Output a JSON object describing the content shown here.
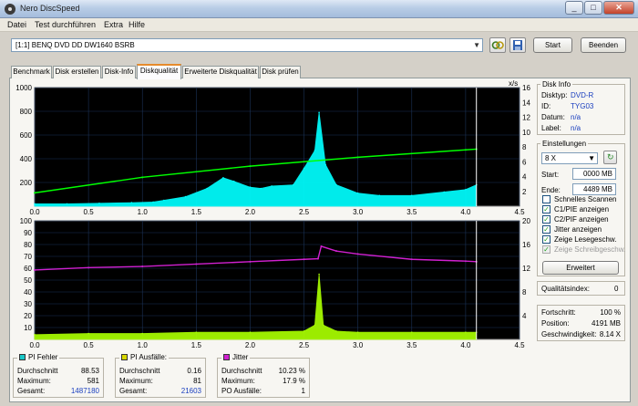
{
  "window": {
    "title": "Nero DiscSpeed"
  },
  "menu": [
    "Datei",
    "Test durchführen",
    "Extra",
    "Hilfe"
  ],
  "toolbar": {
    "drive": "[1:1]  BENQ DVD DD DW1640 BSRB",
    "start_label": "Start",
    "exit_label": "Beenden"
  },
  "tabs": [
    "Benchmark",
    "Disk erstellen",
    "Disk-Info",
    "Diskqualität",
    "Erweiterte Diskqualität",
    "Disk prüfen"
  ],
  "active_tab": 3,
  "disc_info": {
    "title": "Disk Info",
    "rows": [
      {
        "label": "Disktyp:",
        "value": "DVD-R"
      },
      {
        "label": "ID:",
        "value": "TYG03"
      },
      {
        "label": "Datum:",
        "value": "n/a"
      },
      {
        "label": "Label:",
        "value": "n/a"
      }
    ]
  },
  "settings": {
    "title": "Einstellungen",
    "speed": "8 X",
    "start_label": "Start:",
    "start_value": "0000 MB",
    "end_label": "Ende:",
    "end_value": "4489 MB",
    "options": [
      {
        "label": "Schnelles Scannen",
        "checked": false,
        "disabled": false
      },
      {
        "label": "C1/PIE anzeigen",
        "checked": true,
        "disabled": false
      },
      {
        "label": "C2/PIF anzeigen",
        "checked": true,
        "disabled": false
      },
      {
        "label": "Jitter anzeigen",
        "checked": true,
        "disabled": false
      },
      {
        "label": "Zeige Lesegeschw.",
        "checked": true,
        "disabled": false
      },
      {
        "label": "Zeige Schreibgeschw.",
        "checked": true,
        "disabled": true
      }
    ],
    "advanced_label": "Erweitert"
  },
  "quality": {
    "label": "Qualitätsindex:",
    "value": "0"
  },
  "progress": {
    "rows": [
      {
        "label": "Fortschritt:",
        "value": "100 %"
      },
      {
        "label": "Position:",
        "value": "4191 MB"
      },
      {
        "label": "Geschwindigkeit:",
        "value": "8.14 X"
      }
    ]
  },
  "stats": {
    "pi_errors": {
      "title": "PI Fehler",
      "color": "#19c8c8",
      "rows": [
        {
          "label": "Durchschnitt",
          "value": "88.53"
        },
        {
          "label": "Maximum:",
          "value": "581"
        },
        {
          "label": "Gesamt:",
          "value": "1487180"
        }
      ]
    },
    "pi_failures": {
      "title": "PI Ausfälle:",
      "color": "#d7d700",
      "rows": [
        {
          "label": "Durchschnitt",
          "value": "0.16"
        },
        {
          "label": "Maximum:",
          "value": "81"
        },
        {
          "label": "Gesamt:",
          "value": "21603"
        }
      ]
    },
    "jitter": {
      "title": "Jitter",
      "color": "#d020d0",
      "rows": [
        {
          "label": "Durchschnitt",
          "value": "10.23 %"
        },
        {
          "label": "Maximum:",
          "value": "17.9 %"
        },
        {
          "label": "PO Ausfälle:",
          "value": "1"
        }
      ]
    }
  },
  "chart_data": [
    {
      "type": "area",
      "x_ticks": [
        "0.0",
        "0.5",
        "1.0",
        "1.5",
        "2.0",
        "2.5",
        "3.0",
        "3.5",
        "4.0",
        "4.5"
      ],
      "y_left_ticks": [
        "200",
        "400",
        "600",
        "800",
        "1000"
      ],
      "y_right_ticks": [
        "2",
        "4",
        "6",
        "8",
        "10",
        "12",
        "14",
        "16"
      ],
      "xlim": [
        0,
        4.5
      ],
      "ylim_left": [
        0,
        1000
      ],
      "ylim_right": [
        0,
        16
      ],
      "right_unit_label": "x/s",
      "series": [
        {
          "color": "#00ffff",
          "x": [
            0,
            0.3,
            0.6,
            0.9,
            1.1,
            1.2,
            1.4,
            1.6,
            1.75,
            1.85,
            2.0,
            2.1,
            2.2,
            2.4,
            2.5,
            2.6,
            2.64,
            2.7,
            2.8,
            3.0,
            3.2,
            3.5,
            3.8,
            4.0,
            4.1
          ],
          "y": [
            20,
            20,
            25,
            30,
            35,
            50,
            80,
            150,
            240,
            210,
            160,
            150,
            170,
            180,
            320,
            470,
            790,
            350,
            180,
            110,
            90,
            90,
            120,
            140,
            180
          ]
        },
        {
          "color": "#00ff00",
          "x": [
            0,
            1,
            2,
            3,
            4,
            4.1
          ],
          "y": [
            1.8,
            3.9,
            5.4,
            6.6,
            7.6,
            7.7
          ]
        }
      ]
    },
    {
      "type": "area",
      "x_ticks": [
        "0.0",
        "0.5",
        "1.0",
        "1.5",
        "2.0",
        "2.5",
        "3.0",
        "3.5",
        "4.0",
        "4.5"
      ],
      "y_left_ticks": [
        "10",
        "20",
        "30",
        "40",
        "50",
        "60",
        "70",
        "80",
        "90",
        "100"
      ],
      "y_right_ticks": [
        "4",
        "8",
        "12",
        "16",
        "20"
      ],
      "xlim": [
        0,
        4.5
      ],
      "ylim_left": [
        0,
        100
      ],
      "ylim_right": [
        0,
        20
      ],
      "series": [
        {
          "color": "#aaff00",
          "x": [
            0,
            0.5,
            1.0,
            1.5,
            2.0,
            2.5,
            2.6,
            2.64,
            2.68,
            2.8,
            3.0,
            3.5,
            4.0,
            4.1
          ],
          "y": [
            4,
            5,
            5,
            6,
            6,
            7,
            12,
            55,
            12,
            7,
            6,
            6,
            6,
            6
          ]
        },
        {
          "color": "#d020d0",
          "x": [
            0,
            0.5,
            1.0,
            1.5,
            2.0,
            2.5,
            2.63,
            2.66,
            2.8,
            3.0,
            3.5,
            4.0,
            4.1
          ],
          "y": [
            11.7,
            12.1,
            12.3,
            12.7,
            13.1,
            13.5,
            13.6,
            15.7,
            14.9,
            14.4,
            13.5,
            13.2,
            13.1
          ]
        }
      ]
    }
  ]
}
